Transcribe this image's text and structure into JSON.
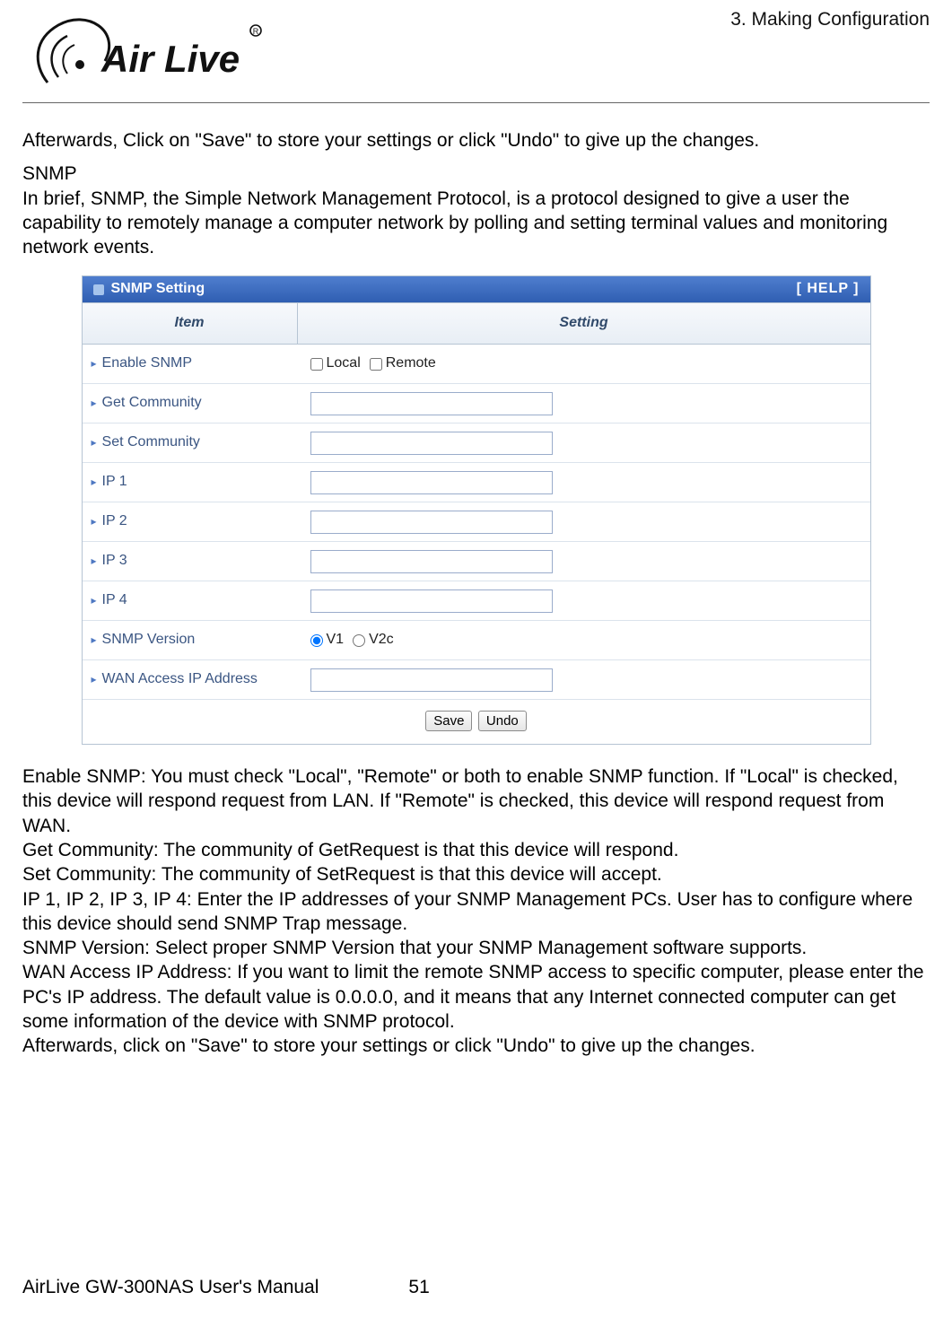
{
  "chapter": "3. Making Configuration",
  "brand": "AirLive",
  "intro_paragraph": "Afterwards, Click on \"Save\" to store your settings or click \"Undo\" to give up the changes.",
  "section_heading": "SNMP",
  "section_text": "In brief, SNMP, the Simple Network Management Protocol, is a protocol designed to give a user the capability to remotely manage a computer network by polling and setting terminal values and monitoring network events.",
  "panel": {
    "title": "SNMP Setting",
    "help_label": "[ HELP ]",
    "columns": {
      "item": "Item",
      "setting": "Setting"
    },
    "rows": {
      "enable_label": "Enable SNMP",
      "enable_local": "Local",
      "enable_remote": "Remote",
      "get_community": "Get Community",
      "set_community": "Set Community",
      "ip1": "IP 1",
      "ip2": "IP 2",
      "ip3": "IP 3",
      "ip4": "IP 4",
      "snmp_version": "SNMP Version",
      "version_v1": "V1",
      "version_v2c": "V2c",
      "wan_access": "WAN Access IP Address"
    },
    "buttons": {
      "save": "Save",
      "undo": "Undo"
    }
  },
  "descriptions": {
    "enable": "Enable SNMP: You must check \"Local\", \"Remote\" or both to enable SNMP function. If \"Local\" is checked, this device will respond request from LAN. If \"Remote\" is checked, this device will respond request from WAN.",
    "get": "Get Community: The community of GetRequest is that this device will respond.",
    "set": "Set Community: The community of SetRequest is that this device will accept.",
    "ips": "IP 1, IP 2, IP 3, IP 4: Enter the IP addresses of your SNMP Management PCs. User has to configure where this device should send SNMP Trap message.",
    "version": "SNMP Version: Select proper SNMP Version that your SNMP Management software supports.",
    "wan": "WAN Access IP Address: If you want to limit the remote SNMP access to specific computer, please enter the PC's IP address. The default value is 0.0.0.0, and it means that any Internet connected computer can get some information of the device with SNMP protocol.",
    "final": "Afterwards, click on \"Save\" to store your settings or click \"Undo\" to give up the changes."
  },
  "footer": {
    "manual": "AirLive GW-300NAS User's Manual",
    "page": "51"
  }
}
